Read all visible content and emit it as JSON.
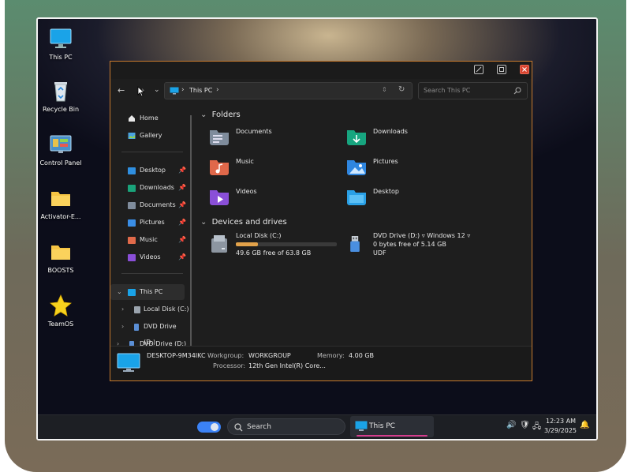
{
  "desktop": {
    "icons": [
      {
        "label": "This PC"
      },
      {
        "label": "Recycle Bin"
      },
      {
        "label": "Control Panel"
      },
      {
        "label": "Activator-E..."
      },
      {
        "label": "BOOSTS"
      },
      {
        "label": "TeamOS"
      }
    ]
  },
  "explorer": {
    "address": {
      "path": "This PC",
      "separator": "›"
    },
    "search_placeholder": "Search This PC",
    "sidebar": {
      "top": [
        {
          "label": "Home"
        },
        {
          "label": "Gallery"
        }
      ],
      "pinned": [
        {
          "label": "Desktop"
        },
        {
          "label": "Downloads"
        },
        {
          "label": "Documents"
        },
        {
          "label": "Pictures"
        },
        {
          "label": "Music"
        },
        {
          "label": "Videos"
        }
      ],
      "tree": [
        {
          "label": "This PC"
        },
        {
          "label": "Local Disk (C:)"
        },
        {
          "label": "DVD Drive (D:)"
        },
        {
          "label": "DVD Drive (D:) ‹"
        }
      ]
    },
    "sections": {
      "folders_title": "Folders",
      "drives_title": "Devices and drives"
    },
    "folders": [
      {
        "label": "Documents"
      },
      {
        "label": "Downloads"
      },
      {
        "label": "Music"
      },
      {
        "label": "Pictures"
      },
      {
        "label": "Videos"
      },
      {
        "label": "Desktop"
      }
    ],
    "drives": [
      {
        "label": "Local Disk (C:)",
        "free": "49.6 GB free of 63.8 GB",
        "used_fraction": 0.22
      },
      {
        "label": "DVD Drive (D:) ▿ Windows 12 ▿",
        "free": "0 bytes free of 5.14 GB",
        "fs": "UDF"
      }
    ],
    "details": {
      "computer": "DESKTOP-9M34IKC",
      "workgroup_label": "Workgroup:",
      "workgroup": "WORKGROUP",
      "memory_label": "Memory:",
      "memory": "4.00 GB",
      "processor_label": "Processor:",
      "processor": "12th Gen Intel(R) Core..."
    }
  },
  "taskbar": {
    "search_label": "Search",
    "active_app": "This PC",
    "time": "12:23 AM",
    "date": "3/29/2025"
  },
  "colors": {
    "accent": "#c77a2e",
    "taskbar_active": "#d63d8e",
    "toggle": "#3b82f6"
  }
}
